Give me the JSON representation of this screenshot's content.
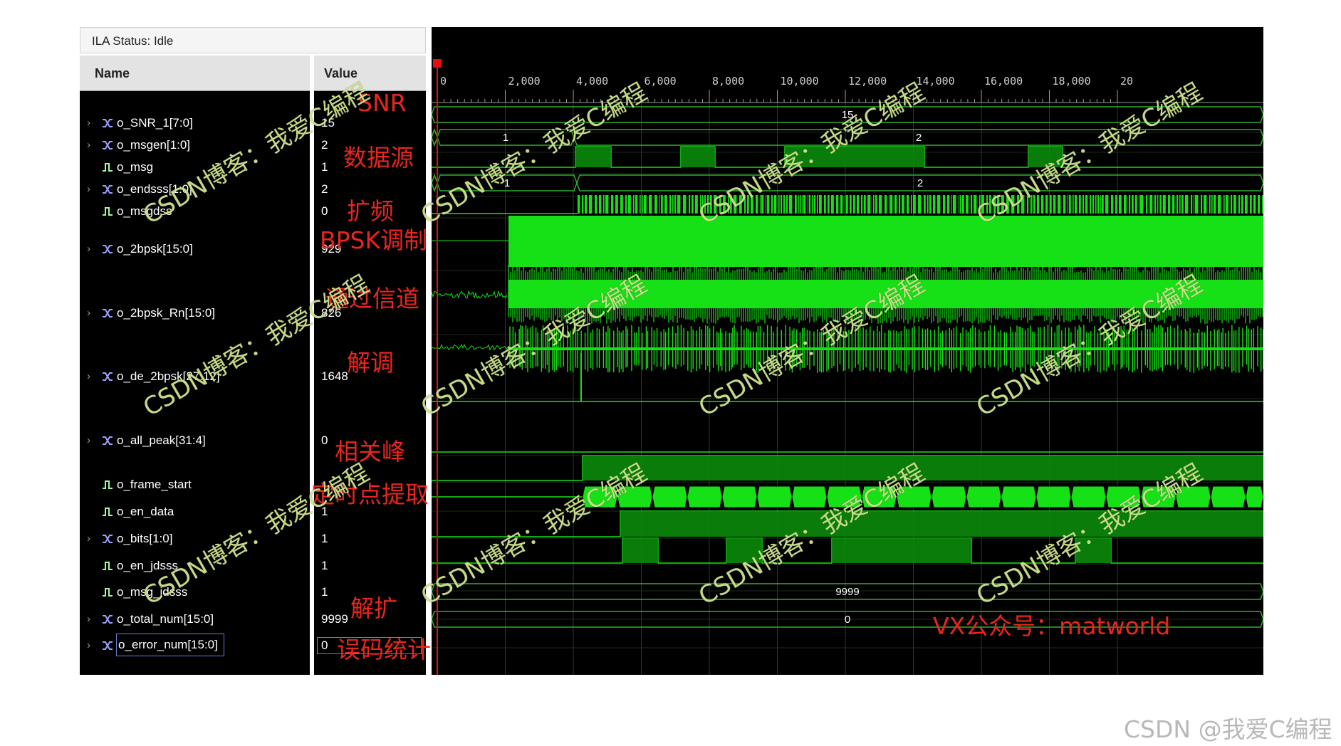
{
  "ila": {
    "status_text": "ILA Status:  Idle",
    "name_header": "Name",
    "value_header": "Value"
  },
  "signals": [
    {
      "name": "o_SNR_1[7:0]",
      "value": "15",
      "type": "bus",
      "expandable": true
    },
    {
      "name": "o_msgen[1:0]",
      "value": "2",
      "type": "bus",
      "expandable": true
    },
    {
      "name": "o_msg",
      "value": "1",
      "type": "bit",
      "expandable": false
    },
    {
      "name": "o_endsss[1:0]",
      "value": "2",
      "type": "bus",
      "expandable": true
    },
    {
      "name": "o_msgdss",
      "value": "0",
      "type": "bit",
      "expandable": false
    },
    {
      "name": "o_2bpsk[15:0]",
      "value": "929",
      "type": "bus",
      "expandable": true
    },
    {
      "name": "o_2bpsk_Rn[15:0]",
      "value": "826",
      "type": "bus",
      "expandable": true
    },
    {
      "name": "o_de_2bpsk[27:12]",
      "value": "1648",
      "type": "bus",
      "expandable": true
    },
    {
      "name": "o_all_peak[31:4]",
      "value": "0",
      "type": "bus",
      "expandable": true
    },
    {
      "name": "o_frame_start",
      "value": "",
      "type": "bit",
      "expandable": false
    },
    {
      "name": "o_en_data",
      "value": "1",
      "type": "bit",
      "expandable": false
    },
    {
      "name": "o_bits[1:0]",
      "value": "1",
      "type": "bus",
      "expandable": true
    },
    {
      "name": "o_en_jdsss",
      "value": "1",
      "type": "bit",
      "expandable": false
    },
    {
      "name": "o_msg_jdsss",
      "value": "1",
      "type": "bit",
      "expandable": false
    },
    {
      "name": "o_total_num[15:0]",
      "value": "9999",
      "type": "bus",
      "expandable": true
    },
    {
      "name": "o_error_num[15:0]",
      "value": "0",
      "type": "bus",
      "expandable": true,
      "selected": true
    }
  ],
  "annotations": [
    "SNR",
    "数据源",
    "扩频",
    "BPSK调制",
    "通过信道",
    "解调",
    "相关峰",
    "定时点提取",
    "解扩",
    "误码统计"
  ],
  "timeline": {
    "ticks": [
      "0",
      "2,000",
      "4,000",
      "6,000",
      "8,000",
      "10,000",
      "12,000",
      "14,000",
      "16,000",
      "18,000",
      "20"
    ]
  },
  "bus_values": {
    "snr": "15",
    "msgen_before": "1",
    "msgen_after": "2",
    "endsss_before": "1",
    "endsss_after": "2",
    "total_num": "9999",
    "error_num": "0"
  },
  "watermarks": {
    "blog": "CSDN博客：我爱C编程",
    "vx": "VX公众号：matworld",
    "footer": "CSDN @我爱C编程"
  },
  "colors": {
    "wave_green": "#16e016",
    "bus_line": "#2fae2f",
    "grid": "#2a3a2a",
    "cursor": "#e01010",
    "annotation": "#e8261d"
  }
}
